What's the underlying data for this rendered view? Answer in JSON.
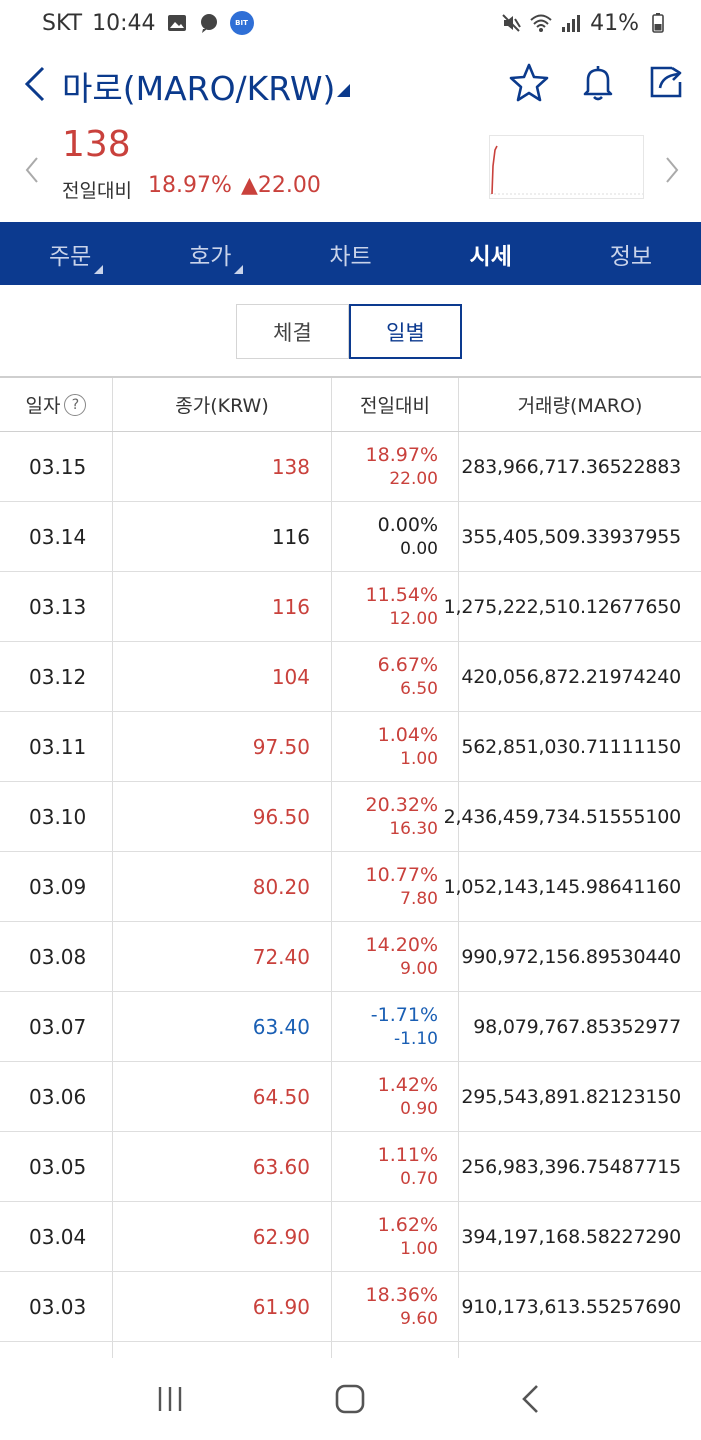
{
  "status": {
    "carrier": "SKT",
    "time": "10:44",
    "battery": "41%",
    "badge_text": "BIT"
  },
  "header": {
    "title": "마로(MARO/KRW)"
  },
  "summary": {
    "price": "138",
    "prev_label": "전일대비",
    "change_pct": "18.97%",
    "change_amt": "▲22.00",
    "colors": {
      "up": "#c9413c",
      "down": "#1a5fb4",
      "brand": "#0c3a8f"
    }
  },
  "tabs": [
    {
      "label": "주문",
      "active": false
    },
    {
      "label": "호가",
      "active": false
    },
    {
      "label": "차트",
      "active": false
    },
    {
      "label": "시세",
      "active": true
    },
    {
      "label": "정보",
      "active": false
    }
  ],
  "segment": {
    "left": "체결",
    "right": "일별"
  },
  "table": {
    "headers": [
      "일자",
      "종가(KRW)",
      "전일대비",
      "거래량(MARO)"
    ],
    "help": "?",
    "rows": [
      {
        "date": "03.15",
        "close": "138",
        "pct": "18.97%",
        "amt": "22.00",
        "vol": "283,966,717.36522883",
        "dir": "up"
      },
      {
        "date": "03.14",
        "close": "116",
        "pct": "0.00%",
        "amt": "0.00",
        "vol": "355,405,509.33937955",
        "dir": "flat"
      },
      {
        "date": "03.13",
        "close": "116",
        "pct": "11.54%",
        "amt": "12.00",
        "vol": "1,275,222,510.12677650",
        "dir": "up"
      },
      {
        "date": "03.12",
        "close": "104",
        "pct": "6.67%",
        "amt": "6.50",
        "vol": "420,056,872.21974240",
        "dir": "up"
      },
      {
        "date": "03.11",
        "close": "97.50",
        "pct": "1.04%",
        "amt": "1.00",
        "vol": "562,851,030.71111150",
        "dir": "up"
      },
      {
        "date": "03.10",
        "close": "96.50",
        "pct": "20.32%",
        "amt": "16.30",
        "vol": "2,436,459,734.51555100",
        "dir": "up"
      },
      {
        "date": "03.09",
        "close": "80.20",
        "pct": "10.77%",
        "amt": "7.80",
        "vol": "1,052,143,145.98641160",
        "dir": "up"
      },
      {
        "date": "03.08",
        "close": "72.40",
        "pct": "14.20%",
        "amt": "9.00",
        "vol": "990,972,156.89530440",
        "dir": "up"
      },
      {
        "date": "03.07",
        "close": "63.40",
        "pct": "-1.71%",
        "amt": "-1.10",
        "vol": "98,079,767.85352977",
        "dir": "down"
      },
      {
        "date": "03.06",
        "close": "64.50",
        "pct": "1.42%",
        "amt": "0.90",
        "vol": "295,543,891.82123150",
        "dir": "up"
      },
      {
        "date": "03.05",
        "close": "63.60",
        "pct": "1.11%",
        "amt": "0.70",
        "vol": "256,983,396.75487715",
        "dir": "up"
      },
      {
        "date": "03.04",
        "close": "62.90",
        "pct": "1.62%",
        "amt": "1.00",
        "vol": "394,197,168.58227290",
        "dir": "up"
      },
      {
        "date": "03.03",
        "close": "61.90",
        "pct": "18.36%",
        "amt": "9.60",
        "vol": "910,173,613.55257690",
        "dir": "up"
      }
    ]
  },
  "icons": {
    "back": "chevron-left-icon",
    "star": "star-icon",
    "bell": "bell-icon",
    "share": "share-icon",
    "recents": "recents-icon",
    "home": "home-icon",
    "nav_back": "nav-back-icon"
  }
}
